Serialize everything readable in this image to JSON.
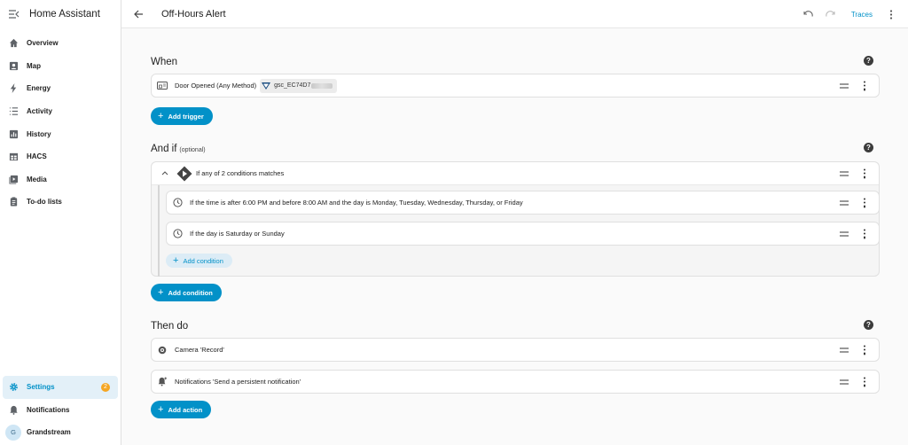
{
  "app": {
    "title": "Home Assistant"
  },
  "sidebar": {
    "items": [
      {
        "label": "Overview",
        "icon": "home-icon"
      },
      {
        "label": "Map",
        "icon": "map-icon"
      },
      {
        "label": "Energy",
        "icon": "lightning-icon"
      },
      {
        "label": "Activity",
        "icon": "list-icon"
      },
      {
        "label": "History",
        "icon": "chart-icon"
      },
      {
        "label": "HACS",
        "icon": "hacs-icon"
      },
      {
        "label": "Media",
        "icon": "media-icon"
      },
      {
        "label": "To-do lists",
        "icon": "clipboard-icon"
      }
    ],
    "settings": {
      "label": "Settings",
      "badge": "2"
    },
    "notifications": {
      "label": "Notifications"
    },
    "user": {
      "label": "Grandstream",
      "initial": "G"
    }
  },
  "header": {
    "title": "Off-Hours Alert",
    "traces": "Traces"
  },
  "when": {
    "heading": "When",
    "trigger": {
      "label": "Door Opened (Any Method)",
      "device": "gsc_EC74D7"
    },
    "add_button": "Add trigger"
  },
  "and_if": {
    "heading": "And if",
    "optional": "(optional)",
    "group_label": "If any of 2 conditions matches",
    "conditions": [
      "If the time is after 6:00 PM and before 8:00 AM and the day is Monday, Tuesday, Wednesday, Thursday, or Friday",
      "If the day is Saturday or Sunday"
    ],
    "add_inner": "Add condition",
    "add_button": "Add condition"
  },
  "then_do": {
    "heading": "Then do",
    "actions": [
      "Camera 'Record'",
      "Notifications 'Send a persistent notification'"
    ],
    "add_button": "Add action"
  },
  "colors": {
    "accent": "#0291c8",
    "badge": "#f5a623",
    "active_bg": "#e3f0f8"
  }
}
